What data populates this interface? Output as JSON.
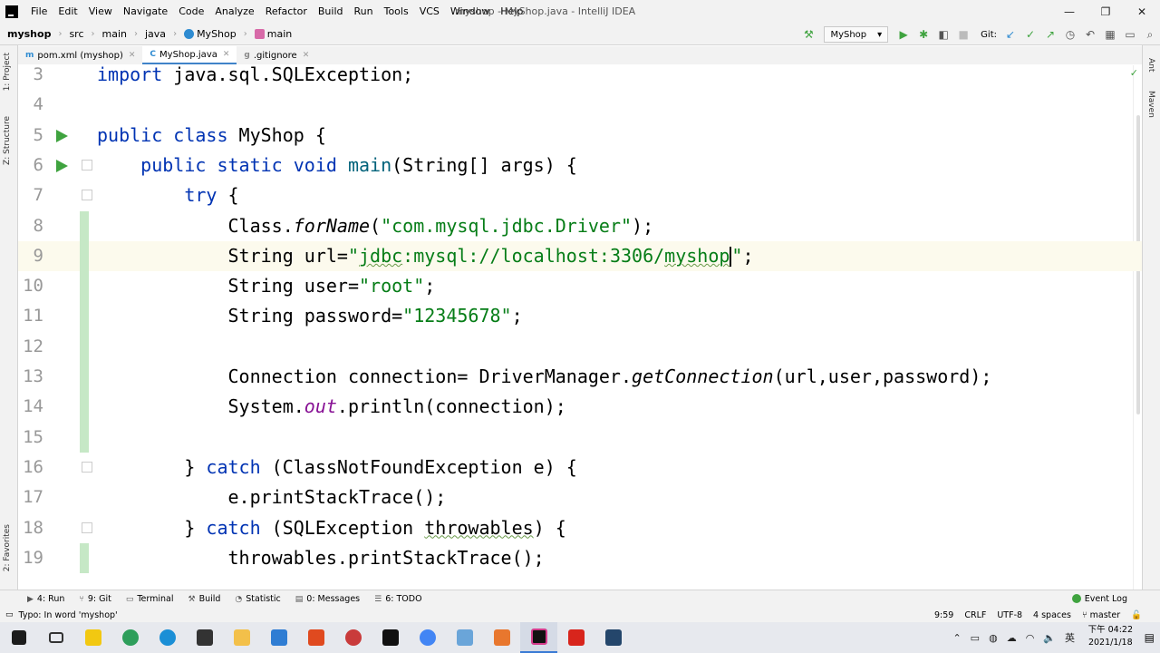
{
  "window": {
    "title": "myshop - MyShop.java - IntelliJ IDEA",
    "menu": [
      "File",
      "Edit",
      "View",
      "Navigate",
      "Code",
      "Analyze",
      "Refactor",
      "Build",
      "Run",
      "Tools",
      "VCS",
      "Window",
      "Help"
    ]
  },
  "breadcrumb": [
    "myshop",
    "src",
    "main",
    "java",
    "MyShop",
    "main"
  ],
  "toolbar": {
    "run_config": "MyShop",
    "git_label": "Git:"
  },
  "left_strip": [
    "1: Project",
    "Z: Structure",
    "2: Favorites"
  ],
  "right_strip": [
    "Ant",
    "Maven"
  ],
  "tabs": [
    {
      "label": "pom.xml (myshop)",
      "icon": "m"
    },
    {
      "label": "MyShop.java",
      "icon": "C"
    },
    {
      "label": ".gitignore",
      "icon": "g"
    }
  ],
  "editor": {
    "lines": [
      {
        "n": "3"
      },
      {
        "n": "4"
      },
      {
        "n": "5"
      },
      {
        "n": "6"
      },
      {
        "n": "7"
      },
      {
        "n": "8"
      },
      {
        "n": "9"
      },
      {
        "n": "10"
      },
      {
        "n": "11"
      },
      {
        "n": "12"
      },
      {
        "n": "13"
      },
      {
        "n": "14"
      },
      {
        "n": "15"
      },
      {
        "n": "16"
      },
      {
        "n": "17"
      },
      {
        "n": "18"
      },
      {
        "n": "19"
      }
    ],
    "code": {
      "l3_kw": "import",
      "l3_rest": " java.sql.SQLException;",
      "l5_kw": "public class",
      "l5_rest": " MyShop {",
      "l6_kw": "public static void",
      "l6_name": " main",
      "l6_rest": "(String[] args) {",
      "l7_kw": "try",
      "l7_rest": " {",
      "l8_a": "Class.",
      "l8_m": "forName",
      "l8_b": "(",
      "l8_s": "\"com.mysql.jdbc.Driver\"",
      "l8_c": ");",
      "l9_a": "String url=",
      "l9_s1": "\"",
      "l9_s2": "jdbc",
      "l9_s3": ":mysql://localhost:3306/",
      "l9_s4": "myshop",
      "l9_s5": "\"",
      "l9_c": ";",
      "l10_a": "String user=",
      "l10_s": "\"root\"",
      "l10_c": ";",
      "l11_a": "String password=",
      "l11_s": "\"12345678\"",
      "l11_c": ";",
      "l13_a": "Connection connection= DriverManager.",
      "l13_m": "getConnection",
      "l13_b": "(url,user,password);",
      "l14_a": "System.",
      "l14_f": "out",
      "l14_b": ".println(connection);",
      "l16_a": "} ",
      "l16_kw": "catch",
      "l16_b": " (ClassNotFoundException e) {",
      "l17_a": "e.printStackTrace();",
      "l18_a": "} ",
      "l18_kw": "catch",
      "l18_b": " (SQLException ",
      "l18_t": "throwables",
      "l18_c": ") {",
      "l19_a": "throwables.printStackTrace();"
    }
  },
  "bottom_tabs": [
    {
      "label": "4: Run",
      "icon": "▶"
    },
    {
      "label": "9: Git",
      "icon": "⑂"
    },
    {
      "label": "Terminal",
      "icon": "▭"
    },
    {
      "label": "Build",
      "icon": "⚒"
    },
    {
      "label": "Statistic",
      "icon": "◔"
    },
    {
      "label": "0: Messages",
      "icon": "▤"
    },
    {
      "label": "6: TODO",
      "icon": "☰"
    }
  ],
  "event_log": "Event Log",
  "status": {
    "message": "Typo: In word 'myshop'",
    "position": "9:59",
    "line_sep": "CRLF",
    "encoding": "UTF-8",
    "indent": "4 spaces",
    "branch": "master"
  },
  "taskbar": {
    "time": "下午 04:22",
    "date": "2021/1/18",
    "ime": "英"
  },
  "colors": {
    "keyword": "#0033b3",
    "string": "#067d17",
    "field": "#871094",
    "run_arrow": "#3fa33f"
  }
}
